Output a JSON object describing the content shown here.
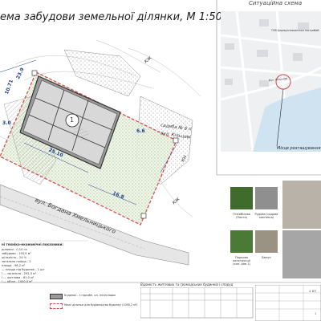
{
  "title": "ема забудови земельної ділянки, М 1:500",
  "situation_title": "Ситуаційна схема",
  "map": {
    "business_name": "ТОВ Церквуспокоєнська пострибаб",
    "street": "Вул. Кільцева",
    "callout": "Місце розташування"
  },
  "site": {
    "building_number": "1",
    "lot_label_line1": "садиба № 6 п",
    "lot_label_line2": "вул. Кільцеві",
    "street_name": "вул. Богдана Хмельницького",
    "dim_top_a": "10.71",
    "dim_top_b": "23.9",
    "dim_left": "3.0",
    "dim_mid": "25.10",
    "dim_right": "6.6",
    "dim_bottom": "16.8",
    "marker_kzh_top": "КЖ",
    "marker_kzh_right": "КЖ",
    "marker_kh": "КН"
  },
  "photos": [
    {
      "label": "Гінкобілова (Пахта)"
    },
    {
      "label": "Рудова (садова кам'янка)"
    },
    {
      "label": "Гінкобілова обмаджака (міра)"
    },
    {
      "label": "Паркова конструкції (кон. рав 1)"
    },
    {
      "label": "Валун"
    },
    {
      "label": "Газон"
    }
  ],
  "legend": {
    "title": "ні техніко-економічні показники:",
    "lines": [
      "ділянки - 0,10 га",
      "забудови - 193,9 м²",
      "щільність - 24 %",
      "загальна площа - 2",
      "площа - 96,2 м²",
      "— площа під будинок - 1 шт",
      "і — загальна - 292,3 м²",
      "і — житлова - 61,0 м²",
      "і — об'єм - 1000,0 м³"
    ],
    "symbol1": "Будинок - з підсобн. ол. ппл/кладок",
    "symbol2": "Межі ділянки для будівництва будинку (1090,2 м²)"
  },
  "table_title": "Відомість житлових та громадських будинків і споруд",
  "title_block": {
    "code": "4 БП",
    "sheet": "1"
  },
  "colors": {
    "boundary": "#d64545",
    "building": "#606060",
    "green": "#8aa86a",
    "water": "#cfe3f0",
    "road": "#ffffff"
  }
}
